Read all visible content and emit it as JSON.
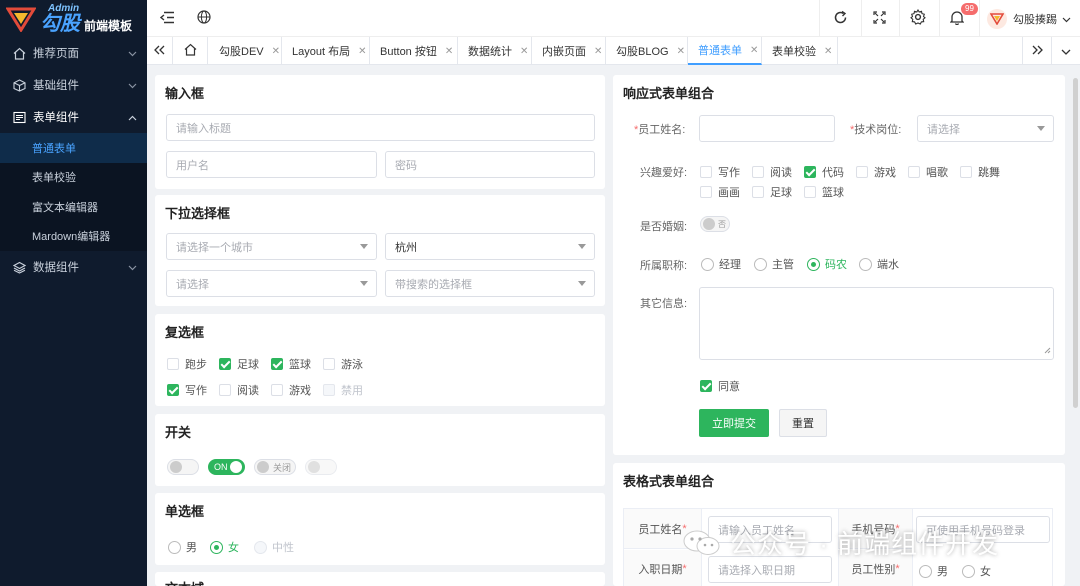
{
  "logo": {
    "admin": "Admin",
    "main": "勾股",
    "sub": "前端模板"
  },
  "sidebar": {
    "items": [
      {
        "label": "推荐页面"
      },
      {
        "label": "基础组件"
      },
      {
        "label": "表单组件"
      },
      {
        "label": "数据组件"
      }
    ],
    "sub_items": [
      {
        "label": "普通表单"
      },
      {
        "label": "表单校验"
      },
      {
        "label": "富文本编辑器"
      },
      {
        "label": "Mardown编辑器"
      }
    ]
  },
  "header": {
    "notification_count": "99",
    "user_name": "勾股揍踢"
  },
  "tabs": [
    {
      "label": "勾股DEV"
    },
    {
      "label": "Layout 布局"
    },
    {
      "label": "Button 按钮"
    },
    {
      "label": "数据统计"
    },
    {
      "label": "内嵌页面"
    },
    {
      "label": "勾股BLOG"
    },
    {
      "label": "普通表单"
    },
    {
      "label": "表单校验"
    }
  ],
  "input_card": {
    "title": "输入框",
    "title_placeholder": "请输入标题",
    "username_placeholder": "用户名",
    "password_placeholder": "密码"
  },
  "select_card": {
    "title": "下拉选择框",
    "city_placeholder": "请选择一个城市",
    "city_value": "杭州",
    "select_placeholder": "请选择",
    "search_placeholder": "带搜索的选择框"
  },
  "checkbox_card": {
    "title": "复选框",
    "options": [
      {
        "label": "跑步"
      },
      {
        "label": "足球"
      },
      {
        "label": "篮球"
      },
      {
        "label": "游泳"
      },
      {
        "label": "写作"
      },
      {
        "label": "阅读"
      },
      {
        "label": "游戏"
      },
      {
        "label": "禁用"
      }
    ]
  },
  "switch_card": {
    "title": "开关",
    "on_label": "ON",
    "off_label": "关闭"
  },
  "radio_card": {
    "title": "单选框",
    "options": [
      {
        "label": "男"
      },
      {
        "label": "女"
      },
      {
        "label": "中性"
      }
    ]
  },
  "textarea_card": {
    "title": "文本域"
  },
  "responsive_form": {
    "title": "响应式表单组合",
    "name_label": "员工姓名:",
    "post_label": "技术岗位:",
    "post_placeholder": "请选择",
    "hobby_label": "兴趣爱好:",
    "hobbies": [
      {
        "label": "写作"
      },
      {
        "label": "阅读"
      },
      {
        "label": "代码"
      },
      {
        "label": "游戏"
      },
      {
        "label": "唱歌"
      },
      {
        "label": "跳舞"
      },
      {
        "label": "画画"
      },
      {
        "label": "足球"
      },
      {
        "label": "篮球"
      }
    ],
    "married_label": "是否婚姻:",
    "married_value": "否",
    "title_label": "所属职称:",
    "titles": [
      {
        "label": "经理"
      },
      {
        "label": "主管"
      },
      {
        "label": "码农"
      },
      {
        "label": "端水"
      }
    ],
    "other_label": "其它信息:",
    "agree_label": "同意",
    "submit_label": "立即提交",
    "reset_label": "重置"
  },
  "table_form": {
    "title": "表格式表单组合",
    "name_label": "员工姓名",
    "name_placeholder": "请输入员工姓名",
    "phone_label": "手机号码",
    "phone_placeholder": "可使用手机号码登录",
    "date_label": "入职日期",
    "date_placeholder": "请选择入职日期",
    "gender_label": "员工性别",
    "genders": [
      {
        "label": "男"
      },
      {
        "label": "女"
      }
    ]
  },
  "watermark": {
    "text": "公众号 · 前端组件开发"
  },
  "colors": {
    "accent": "#2db55d",
    "sidebar_bg": "#0f1b2d",
    "active_tab": "#409eff"
  }
}
